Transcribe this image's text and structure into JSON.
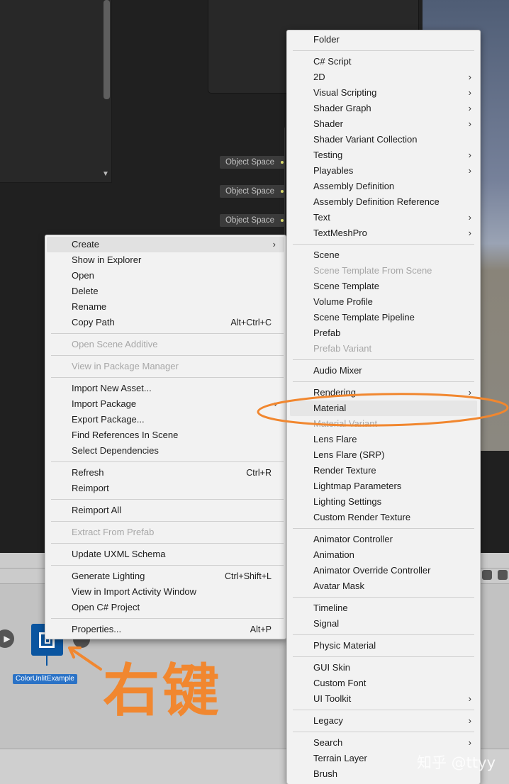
{
  "background": {
    "object_space_ports": [
      "Object Space",
      "Object Space",
      "Object Space"
    ],
    "asset_label": "ColorUnlitExample"
  },
  "context_menu": {
    "groups": [
      [
        {
          "label": "Create",
          "submenu": true,
          "highlighted": true
        },
        {
          "label": "Show in Explorer"
        },
        {
          "label": "Open"
        },
        {
          "label": "Delete"
        },
        {
          "label": "Rename"
        },
        {
          "label": "Copy Path",
          "shortcut": "Alt+Ctrl+C"
        }
      ],
      [
        {
          "label": "Open Scene Additive",
          "disabled": true
        }
      ],
      [
        {
          "label": "View in Package Manager",
          "disabled": true
        }
      ],
      [
        {
          "label": "Import New Asset..."
        },
        {
          "label": "Import Package",
          "submenu": true
        },
        {
          "label": "Export Package..."
        },
        {
          "label": "Find References In Scene"
        },
        {
          "label": "Select Dependencies"
        }
      ],
      [
        {
          "label": "Refresh",
          "shortcut": "Ctrl+R"
        },
        {
          "label": "Reimport"
        }
      ],
      [
        {
          "label": "Reimport All"
        }
      ],
      [
        {
          "label": "Extract From Prefab",
          "disabled": true
        }
      ],
      [
        {
          "label": "Update UXML Schema"
        }
      ],
      [
        {
          "label": "Generate Lighting",
          "shortcut": "Ctrl+Shift+L"
        },
        {
          "label": "View in Import Activity Window"
        },
        {
          "label": "Open C# Project"
        }
      ],
      [
        {
          "label": "Properties...",
          "shortcut": "Alt+P"
        }
      ]
    ]
  },
  "create_submenu": {
    "groups": [
      [
        {
          "label": "Folder"
        }
      ],
      [
        {
          "label": "C# Script"
        },
        {
          "label": "2D",
          "submenu": true
        },
        {
          "label": "Visual Scripting",
          "submenu": true
        },
        {
          "label": "Shader Graph",
          "submenu": true
        },
        {
          "label": "Shader",
          "submenu": true
        },
        {
          "label": "Shader Variant Collection"
        },
        {
          "label": "Testing",
          "submenu": true
        },
        {
          "label": "Playables",
          "submenu": true
        },
        {
          "label": "Assembly Definition"
        },
        {
          "label": "Assembly Definition Reference"
        },
        {
          "label": "Text",
          "submenu": true
        },
        {
          "label": "TextMeshPro",
          "submenu": true
        }
      ],
      [
        {
          "label": "Scene"
        },
        {
          "label": "Scene Template From Scene",
          "disabled": true
        },
        {
          "label": "Scene Template"
        },
        {
          "label": "Volume Profile"
        },
        {
          "label": "Scene Template Pipeline"
        },
        {
          "label": "Prefab"
        },
        {
          "label": "Prefab Variant",
          "disabled": true
        }
      ],
      [
        {
          "label": "Audio Mixer"
        }
      ],
      [
        {
          "label": "Rendering",
          "submenu": true
        },
        {
          "label": "Material",
          "highlighted": true
        },
        {
          "label": "Material Variant",
          "disabled": true
        },
        {
          "label": "Lens Flare"
        },
        {
          "label": "Lens Flare (SRP)"
        },
        {
          "label": "Render Texture"
        },
        {
          "label": "Lightmap Parameters"
        },
        {
          "label": "Lighting Settings"
        },
        {
          "label": "Custom Render Texture"
        }
      ],
      [
        {
          "label": "Animator Controller"
        },
        {
          "label": "Animation"
        },
        {
          "label": "Animator Override Controller"
        },
        {
          "label": "Avatar Mask"
        }
      ],
      [
        {
          "label": "Timeline"
        },
        {
          "label": "Signal"
        }
      ],
      [
        {
          "label": "Physic Material"
        }
      ],
      [
        {
          "label": "GUI Skin"
        },
        {
          "label": "Custom Font"
        },
        {
          "label": "UI Toolkit",
          "submenu": true
        }
      ],
      [
        {
          "label": "Legacy",
          "submenu": true
        }
      ],
      [
        {
          "label": "Search",
          "submenu": true
        },
        {
          "label": "Terrain Layer"
        },
        {
          "label": "Brush"
        }
      ]
    ]
  },
  "annotation": {
    "text": "右键",
    "color": "#f1872f"
  },
  "watermark": "知乎 @ttyy",
  "icons": {
    "submenu_arrow": "chevron-right-icon",
    "play": "play-icon",
    "asset": "shader-asset-icon"
  }
}
